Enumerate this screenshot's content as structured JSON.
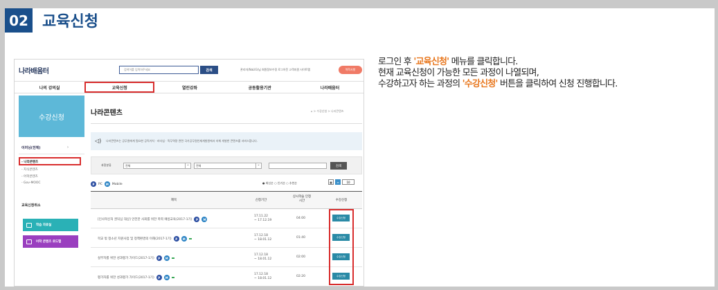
{
  "step": {
    "number": "02",
    "title": "교육신청"
  },
  "description": {
    "line1_prefix": "로그인 후 ",
    "line1_highlight": "'교육신청'",
    "line1_suffix": " 메뉴를 클릭합니다.",
    "line2": "현재 교육신청이 가능한 모든 과정이 나열되며,",
    "line3_prefix": "수강하고자 하는 과정의 ",
    "line3_highlight": "'수강신청'",
    "line3_suffix": " 버튼을 클릭하여 신청 진행합니다."
  },
  "site": {
    "logo": "나라배움터",
    "search_placeholder": "검색어를 입력하주세요",
    "search_button": "검색",
    "utils": "관리자(NaLIG)님  회원정보수정  로그아웃  고객지원  사이트맵",
    "util_button": "역학사항",
    "nav": [
      "나의 강의실",
      "교육신청",
      "열린강좌",
      "공동활용기관",
      "나라배움터"
    ],
    "side": {
      "heading": "수강신청",
      "category": "이러닝(전체)",
      "category_arrow": "›",
      "subs": [
        "- 나라콘텐츠",
        "- 지식콘텐츠",
        "- 어학콘텐츠",
        "- Gov-MOOC"
      ],
      "section": "교육신청취소",
      "buttons": [
        "학습 자료실",
        "어학 콘텐츠 로드맵"
      ]
    },
    "main": {
      "title": "나라콘텐츠",
      "breadcrumb": "⌂ > 수강신청 > 나라콘텐츠",
      "notice": "나라콘텐츠는 공무원에게 필요한 공직가치 · 리더십 · 직무역량 관련 국가공무원인재개발원에서 자체 개발한 콘텐츠를 서비스합니다.",
      "filter_label": "과정분류",
      "filter_sel1": "전체",
      "filter_sel2": "전체",
      "filter_sel3": "",
      "filter_button": "검색",
      "legend_pc": "PC",
      "legend_mobile": "Mobile",
      "sort": "● 최신순  ○ 인기순  ○ 추천순",
      "page_size": "10",
      "columns": [
        "제목",
        "신청기간",
        "상시학습 인정시간",
        "수강신청"
      ],
      "rows": [
        {
          "title": "[인사혁신처 권익심 대상] 안전한 사회를 위한 폭력 예방교육(2017-1기)",
          "date1": "17.11.22",
          "date2": "~ 17.12.19",
          "hours": "04:00",
          "badge": "",
          "button": "수강신청"
        },
        {
          "title": "학교 밖 청소년 지원사업 및 정책환경의 이해(2017-1기)",
          "date1": "17.12.18",
          "date2": "~ 18.01.12",
          "hours": "01:40",
          "badge": "",
          "button": "수강신청"
        },
        {
          "title": "실무자를 위한 성과평가 가이드(2017-1기)",
          "date1": "17.12.18",
          "date2": "~ 18.01.12",
          "hours": "02:00",
          "badge": "",
          "button": "수강신청"
        },
        {
          "title": "평가자를 위한 성과평가 가이드(2017-1기)",
          "date1": "17.12.18",
          "date2": "~ 18.01.12",
          "hours": "02:20",
          "badge": "",
          "button": "수강신청"
        }
      ]
    }
  }
}
